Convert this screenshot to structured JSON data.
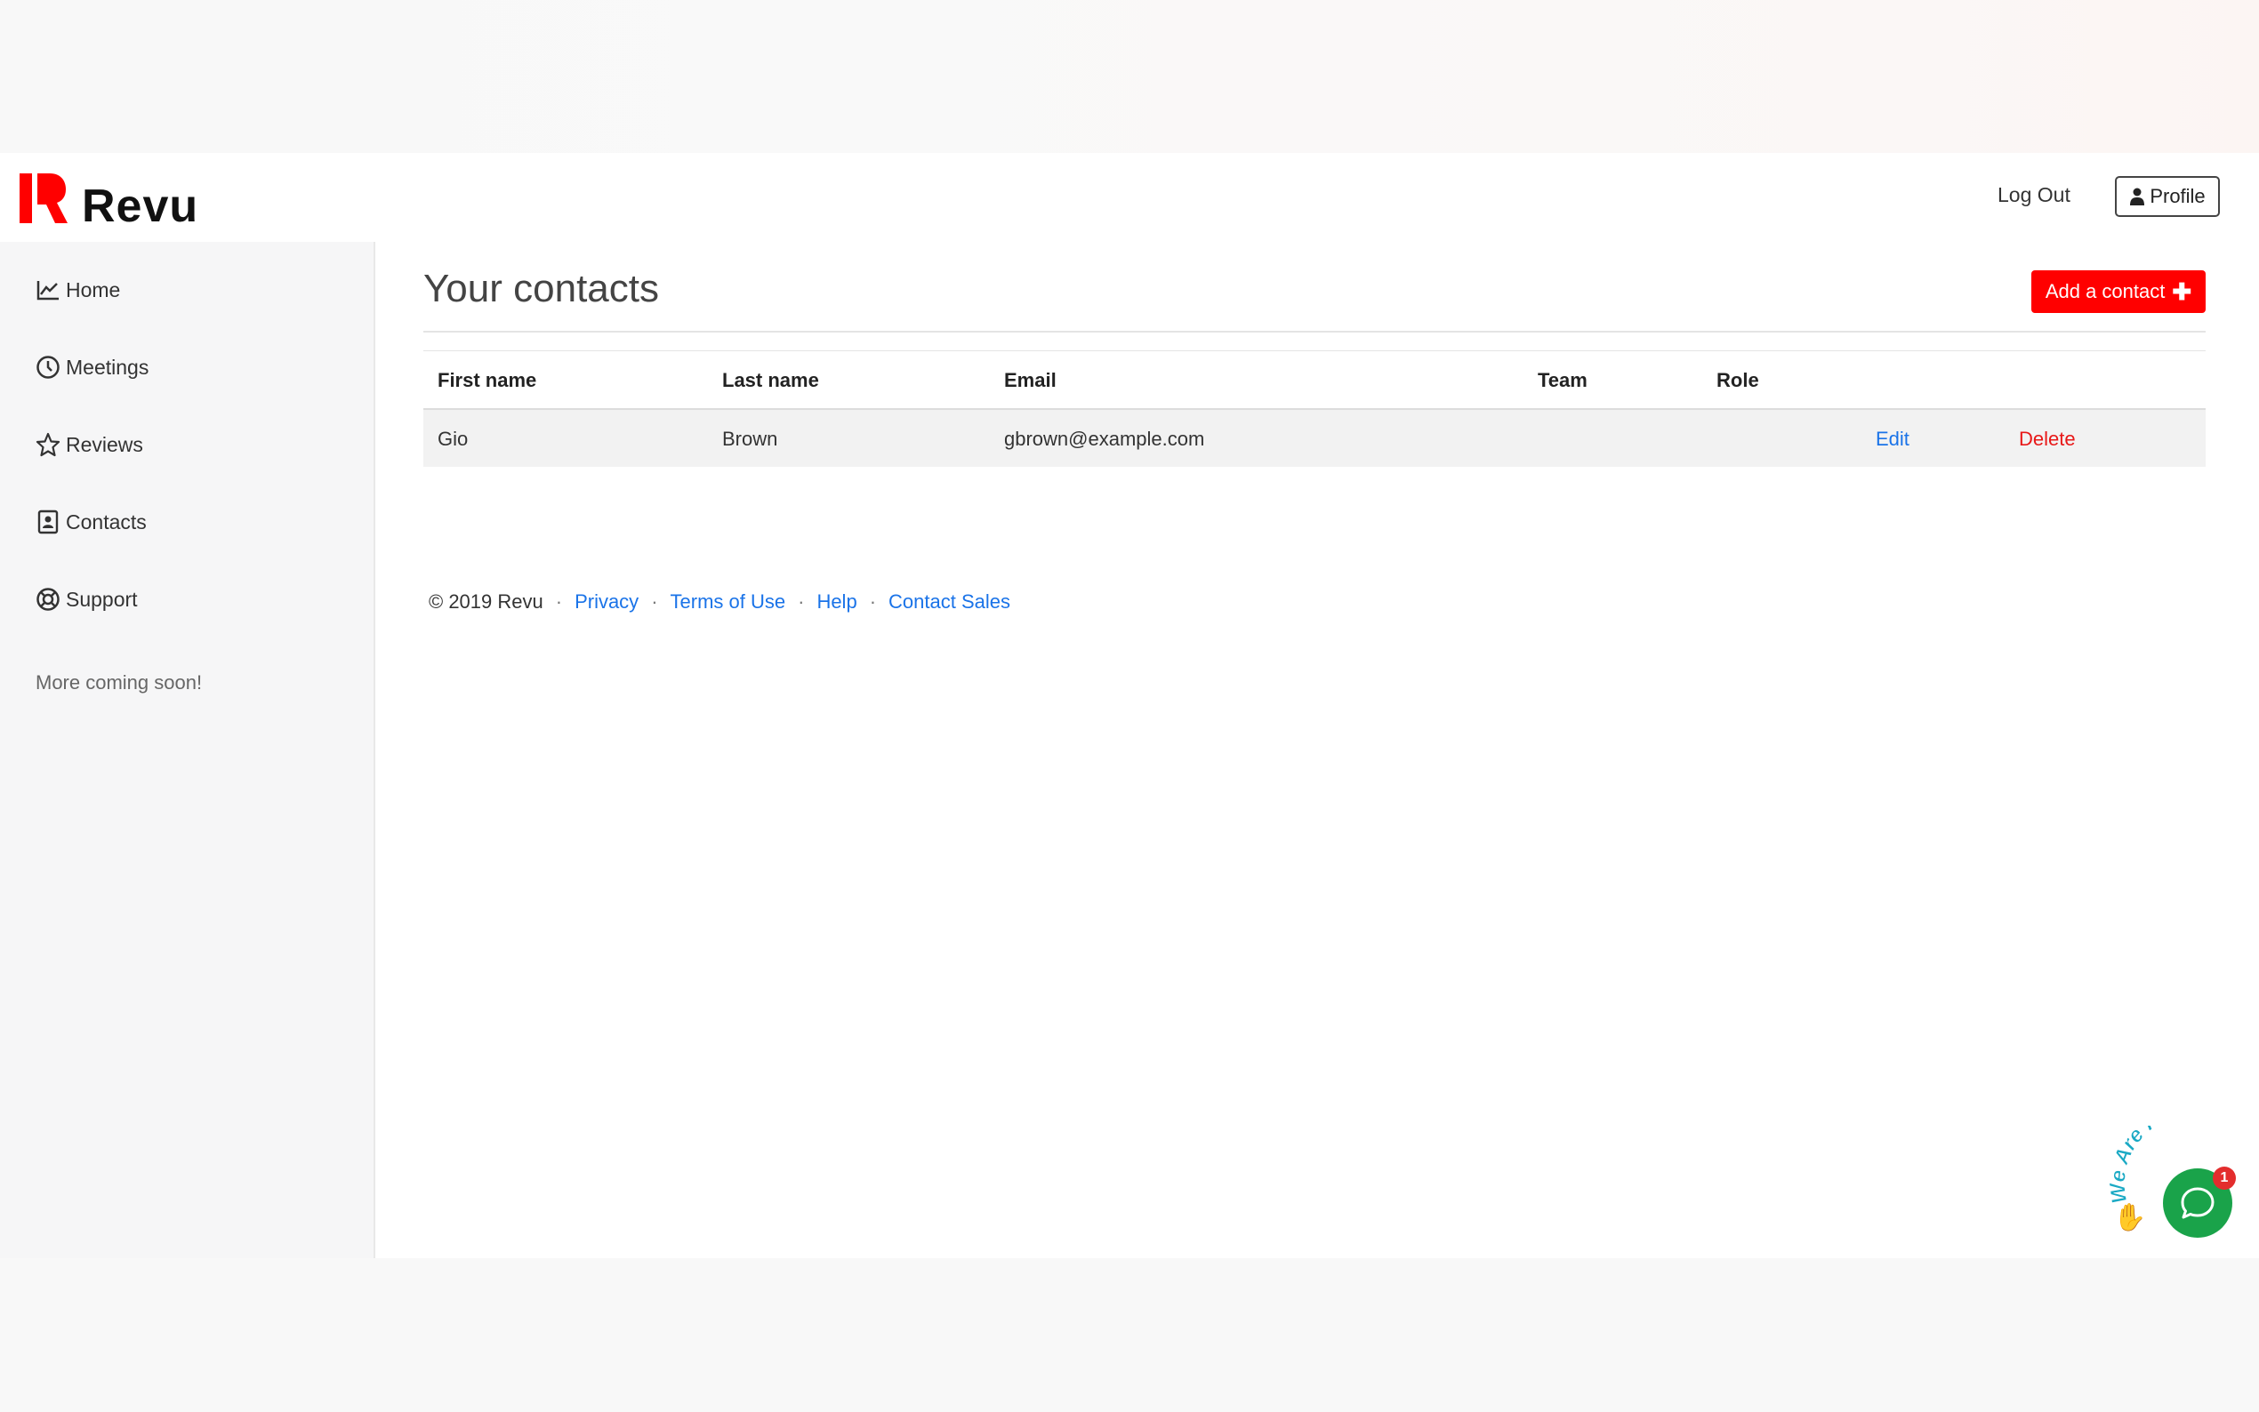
{
  "app": {
    "name": "Revu",
    "brand_color": "#ff0000"
  },
  "header": {
    "logout_label": "Log Out",
    "profile_label": "Profile"
  },
  "sidebar": {
    "items": [
      {
        "label": "Home",
        "icon": "chart-line-icon"
      },
      {
        "label": "Meetings",
        "icon": "clock-icon"
      },
      {
        "label": "Reviews",
        "icon": "star-icon"
      },
      {
        "label": "Contacts",
        "icon": "address-book-icon"
      },
      {
        "label": "Support",
        "icon": "life-ring-icon"
      }
    ],
    "more_text": "More coming soon!"
  },
  "main": {
    "title": "Your contacts",
    "add_label": "Add a contact",
    "table": {
      "headers": [
        "First name",
        "Last name",
        "Email",
        "Team",
        "Role"
      ],
      "rows": [
        {
          "first": "Gio",
          "last": "Brown",
          "email": "gbrown@example.com",
          "team": "",
          "role": "",
          "edit": "Edit",
          "delete": "Delete"
        }
      ]
    }
  },
  "footer": {
    "copyright": "© 2019 Revu",
    "separator": "·",
    "links": [
      "Privacy",
      "Terms of Use",
      "Help",
      "Contact Sales"
    ]
  },
  "chat": {
    "label": "We Are Here!",
    "badge": "1",
    "color": "#1aa34a"
  }
}
